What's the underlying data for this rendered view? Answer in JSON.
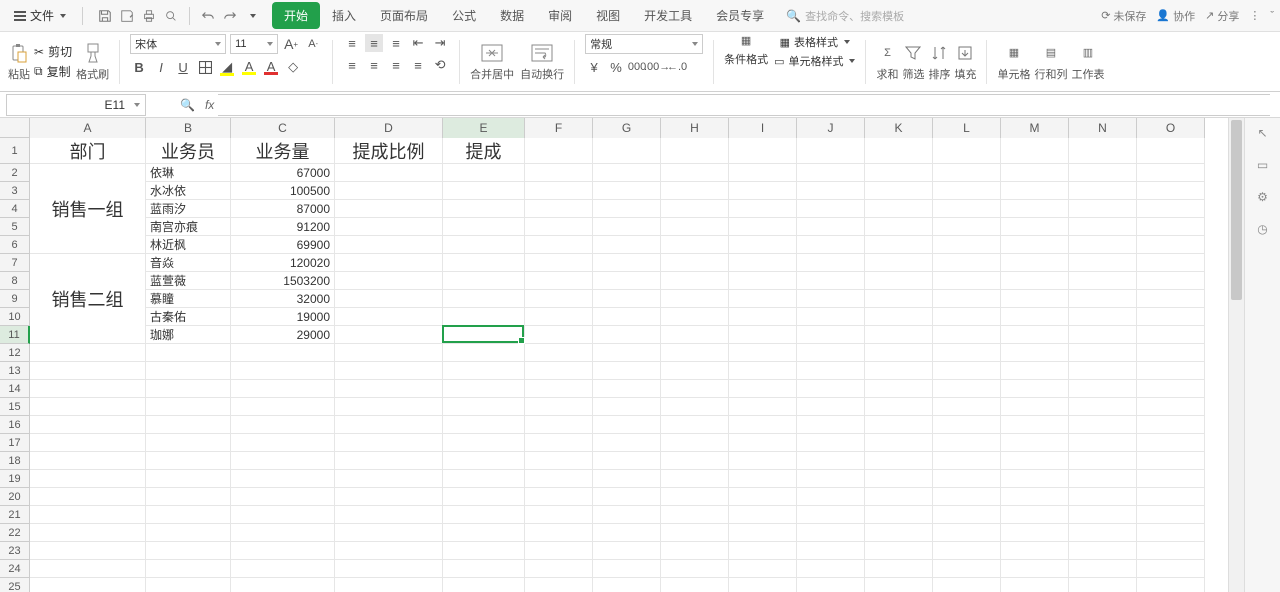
{
  "menubar": {
    "file_label": "文件",
    "tabs": [
      "开始",
      "插入",
      "页面布局",
      "公式",
      "数据",
      "审阅",
      "视图",
      "开发工具",
      "会员专享"
    ],
    "active_tab": 0,
    "search_placeholder": "查找命令、搜索模板",
    "right": {
      "unsaved": "未保存",
      "coop": "协作",
      "share": "分享"
    }
  },
  "ribbon": {
    "paste": "粘贴",
    "cut": "剪切",
    "copy": "复制",
    "format_painter": "格式刷",
    "font_name": "宋体",
    "font_size": "11",
    "merge_center": "合并居中",
    "wrap": "自动换行",
    "number_format": "常规",
    "cond_fmt": "条件格式",
    "table_style": "表格样式",
    "cell_style": "单元格样式",
    "sum": "求和",
    "filter": "筛选",
    "sort": "排序",
    "fill": "填充",
    "cells": "单元格",
    "rowcol": "行和列",
    "worksheet": "工作表"
  },
  "formula_bar": {
    "name_box": "E11",
    "fx": "fx",
    "formula": ""
  },
  "grid": {
    "columns": [
      {
        "name": "A",
        "w": 116
      },
      {
        "name": "B",
        "w": 85
      },
      {
        "name": "C",
        "w": 104
      },
      {
        "name": "D",
        "w": 108
      },
      {
        "name": "E",
        "w": 82
      },
      {
        "name": "F",
        "w": 68
      },
      {
        "name": "G",
        "w": 68
      },
      {
        "name": "H",
        "w": 68
      },
      {
        "name": "I",
        "w": 68
      },
      {
        "name": "J",
        "w": 68
      },
      {
        "name": "K",
        "w": 68
      },
      {
        "name": "L",
        "w": 68
      },
      {
        "name": "M",
        "w": 68
      },
      {
        "name": "N",
        "w": 68
      },
      {
        "name": "O",
        "w": 68
      }
    ],
    "row_heights": {
      "1": 26
    },
    "default_row_h": 18,
    "num_rows": 25,
    "selection": {
      "col": "E",
      "row": 11
    },
    "headers_row": [
      "部门",
      "业务员",
      "业务量",
      "提成比例",
      "提成"
    ],
    "data_rows": [
      {
        "b": "依琳",
        "c": "67000"
      },
      {
        "b": "水冰依",
        "c": "100500"
      },
      {
        "b": "蓝雨汐",
        "c": "87000"
      },
      {
        "b": "南宫亦痕",
        "c": "91200"
      },
      {
        "b": "林近枫",
        "c": "69900"
      },
      {
        "b": "音焱",
        "c": "120020"
      },
      {
        "b": "蓝萱薇",
        "c": "1503200"
      },
      {
        "b": "慕瞳",
        "c": "32000"
      },
      {
        "b": "古秦佑",
        "c": "19000"
      },
      {
        "b": "珈娜",
        "c": "29000"
      }
    ],
    "merges": [
      {
        "col": "A",
        "start": 2,
        "end": 6,
        "text": "销售一组"
      },
      {
        "col": "A",
        "start": 7,
        "end": 11,
        "text": "销售二组"
      }
    ]
  }
}
